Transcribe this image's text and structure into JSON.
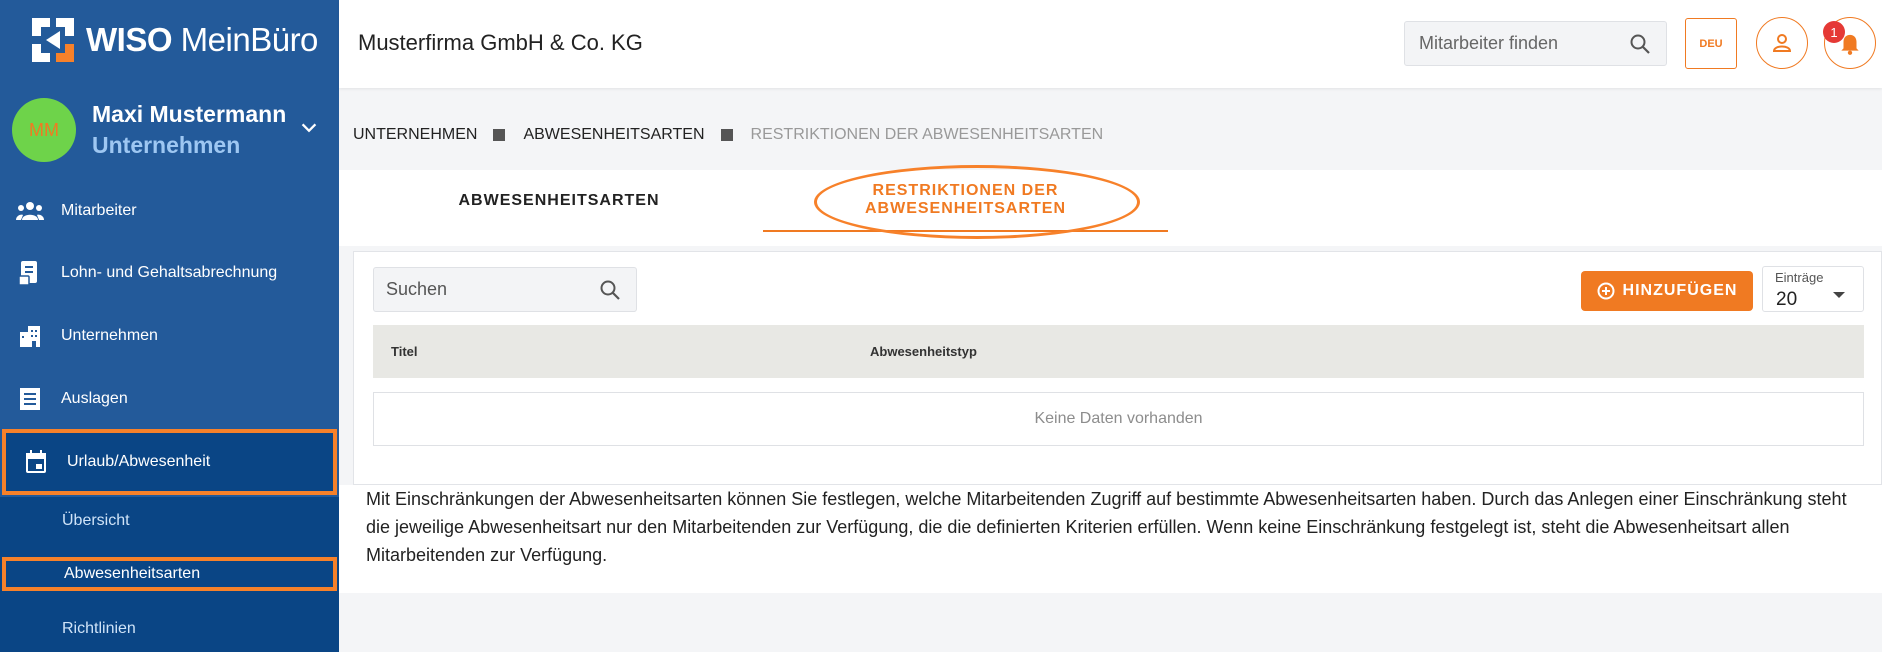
{
  "brand": {
    "name_bold": "WISO",
    "name_light": "MeinBüro",
    "accent": "#f07a22",
    "sidebar_color": "#235a9a"
  },
  "user": {
    "initials": "MM",
    "name": "Maxi Mustermann",
    "role": "Unternehmen"
  },
  "nav": {
    "mitarbeiter": "Mitarbeiter",
    "lohn": "Lohn- und Gehaltsabrechnung",
    "unternehmen": "Unternehmen",
    "auslagen": "Auslagen",
    "urlaub": "Urlaub/Abwesenheit",
    "sub": {
      "uebersicht": "Übersicht",
      "abwesenheitsarten": "Abwesenheitsarten",
      "richtlinien": "Richtlinien"
    }
  },
  "header": {
    "company": "Musterfirma GmbH & Co. KG",
    "search_placeholder": "Mitarbeiter finden",
    "language": "DEU",
    "notification_count": "1"
  },
  "breadcrumb": [
    "UNTERNEHMEN",
    "ABWESENHEITSARTEN",
    "RESTRIKTIONEN DER ABWESENHEITSARTEN"
  ],
  "tabs": {
    "tab1": "ABWESENHEITSARTEN",
    "tab2_line1": "RESTRIKTIONEN DER",
    "tab2_line2": "ABWESENHEITSARTEN"
  },
  "toolbar": {
    "search_placeholder": "Suchen",
    "add_label": "HINZUFÜGEN",
    "entries_label": "Einträge",
    "entries_value": "20"
  },
  "table": {
    "columns": [
      "Titel",
      "Abwesenheitstyp"
    ],
    "empty_text": "Keine Daten vorhanden"
  },
  "description": "Mit Einschränkungen der Abwesenheitsarten können Sie festlegen, welche Mitarbeitenden Zugriff auf bestimmte Abwesenheitsarten haben. Durch das Anlegen einer Einschränkung steht die jeweilige Abwesenheitsart nur den Mitarbeitenden zur Verfügung, die die definierten Kriterien erfüllen. Wenn keine Einschränkung festgelegt ist, steht die Abwesenheitsart allen Mitarbeitenden zur Verfügung."
}
